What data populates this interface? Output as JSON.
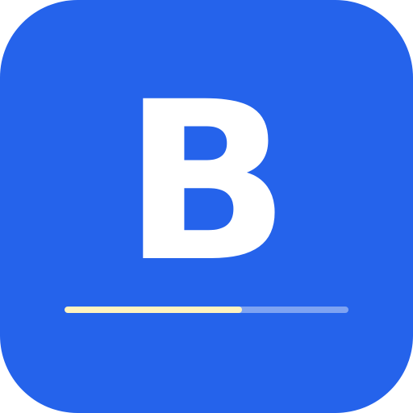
{
  "icon": {
    "glyph": "B",
    "background_color": "#2563eb",
    "glyph_color": "#ffffff"
  },
  "progress": {
    "value": 0.625,
    "fill_color": "#fff3bf",
    "track_color": "#7ea3f2"
  }
}
